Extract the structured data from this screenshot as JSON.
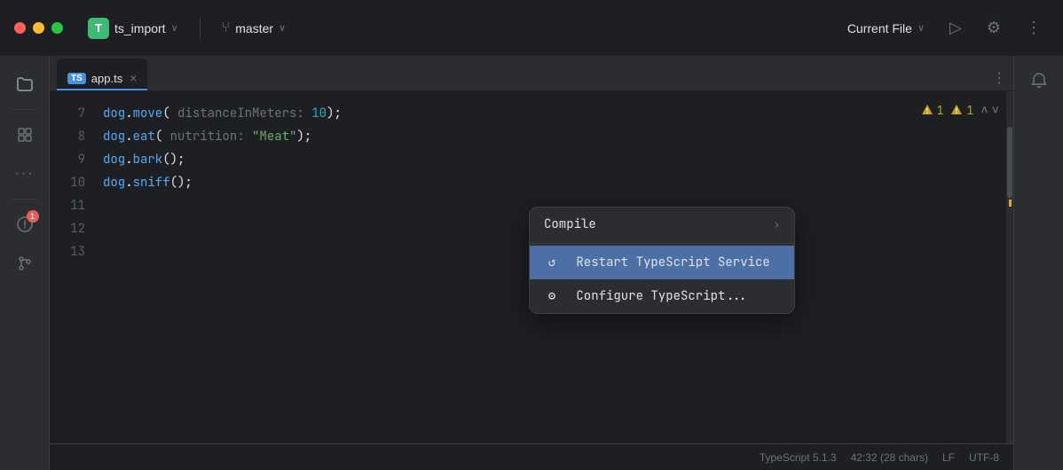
{
  "titlebar": {
    "project_icon_letter": "T",
    "project_name": "ts_import",
    "project_chevron": "∨",
    "branch_icon": "⑂",
    "branch_name": "master",
    "branch_chevron": "∨",
    "current_file_label": "Current File",
    "current_file_chevron": "∨",
    "run_icon": "▷",
    "debug_icon": "⚙",
    "more_icon": "⋮"
  },
  "sidebar": {
    "icons": [
      {
        "name": "folder-icon",
        "glyph": "🗀",
        "active": true,
        "badge": null
      },
      {
        "name": "structure-icon",
        "glyph": "⊞",
        "active": false,
        "badge": null
      },
      {
        "name": "more-icon",
        "glyph": "···",
        "active": false,
        "badge": null
      },
      {
        "name": "problems-icon",
        "glyph": "⚠",
        "active": false,
        "badge": "1"
      },
      {
        "name": "git-icon",
        "glyph": "⑂",
        "active": false,
        "badge": null
      }
    ]
  },
  "tab": {
    "ts_badge": "TS",
    "filename": "app.ts",
    "close_char": "×",
    "more_char": "⋮"
  },
  "code": {
    "lines": [
      {
        "num": 7,
        "content": "dog.move( distanceInMeters: 10);"
      },
      {
        "num": 8,
        "content": "dog.eat( nutrition: \"Meat\");"
      },
      {
        "num": 9,
        "content": "dog.bark();"
      },
      {
        "num": 10,
        "content": "dog.sniff();"
      },
      {
        "num": 11,
        "content": ""
      },
      {
        "num": 12,
        "content": ""
      },
      {
        "num": 13,
        "content": ""
      }
    ],
    "warnings": {
      "count1": "1",
      "count2": "1"
    }
  },
  "context_menu": {
    "items": [
      {
        "id": "compile",
        "label": "Compile",
        "icon": "",
        "has_arrow": true,
        "highlighted": false
      },
      {
        "id": "restart-ts",
        "label": "Restart TypeScript Service",
        "icon": "↺",
        "has_arrow": false,
        "highlighted": true
      },
      {
        "id": "configure-ts",
        "label": "Configure TypeScript...",
        "icon": "⚙",
        "has_arrow": false,
        "highlighted": false
      }
    ]
  },
  "status_bar": {
    "typescript_version": "TypeScript 5.1.3",
    "cursor_position": "42:32 (28 chars)",
    "line_ending": "LF",
    "encoding": "UTF-8"
  }
}
